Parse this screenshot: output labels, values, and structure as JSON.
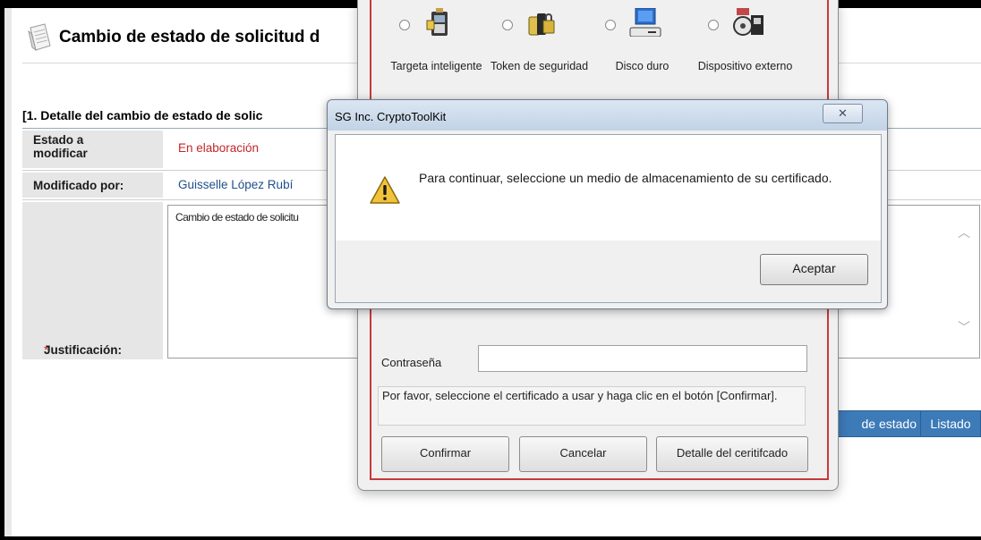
{
  "page": {
    "title": "Cambio de estado de solicitud d",
    "section_title": "[1. Detalle del cambio de estado de solic",
    "rows": {
      "estado_label": "Estado a modificar",
      "estado_value": "En elaboración",
      "modificado_label": "Modificado por:",
      "modificado_value": "Guisselle López Rubí",
      "justificacion_required_mark": "*",
      "justificacion_label": "Justificación:",
      "justificacion_text": "Cambio de estado de solicitu"
    },
    "buttons": {
      "cambio_estado": "de estado",
      "listado": "Listado"
    }
  },
  "cert_window": {
    "storage_options": [
      {
        "label": "Targeta inteligente",
        "icon": "smart-card-icon",
        "selected": false
      },
      {
        "label": "Token de seguridad",
        "icon": "security-token-icon",
        "selected": false
      },
      {
        "label": "Disco duro",
        "icon": "hard-disk-icon",
        "selected": false
      },
      {
        "label": "Dispositivo externo",
        "icon": "external-device-icon",
        "selected": false
      }
    ],
    "password_label": "Contraseña",
    "password_value": "",
    "hint": "Por favor, seleccione el certificado a usar y haga clic en el botón [Confirmar].",
    "buttons": {
      "confirm": "Confirmar",
      "cancel": "Cancelar",
      "detail": "Detalle del ceritifcado"
    }
  },
  "alert": {
    "title": "SG Inc. CryptoToolKit",
    "close_glyph": "✕",
    "icon": "warning-icon",
    "message": "Para continuar, seleccione un medio de almacenamiento de su certificado.",
    "ok_button": "Aceptar"
  },
  "colors": {
    "required": "#c0262a",
    "estado_value": "#c0262a",
    "user_link": "#1f4f8a",
    "page_button": "#3d7ab8",
    "cert_border": "#c8383a"
  }
}
